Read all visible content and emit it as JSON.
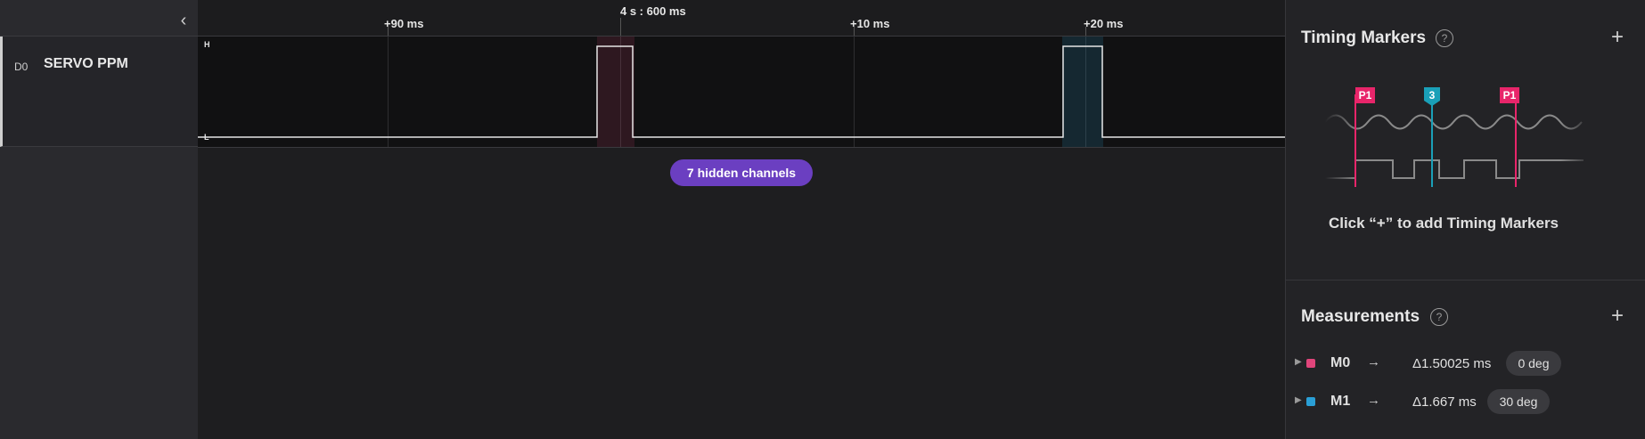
{
  "sidebar": {
    "collapse_icon": "chevron-left-icon",
    "channel": {
      "id": "D0",
      "name": "SERVO PPM"
    }
  },
  "ruler": {
    "cursor_label": "4 s : 600 ms",
    "ticks": [
      "+90 ms",
      "+10 ms",
      "+20 ms"
    ]
  },
  "trace": {
    "high_label": "H",
    "low_label": "L"
  },
  "hidden_channels": "7 hidden channels",
  "timing_markers": {
    "title": "Timing Markers",
    "add_icon": "plus-icon",
    "help_icon": "help-circle-icon",
    "illustration_flags": [
      "P1",
      "3",
      "P1"
    ],
    "hint": "Click “+” to add Timing Markers"
  },
  "measurements": {
    "title": "Measurements",
    "add_icon": "plus-icon",
    "help_icon": "help-circle-icon",
    "items": [
      {
        "name": "M0",
        "color": "#e0457b",
        "arrow": "→",
        "delta": "Δ1.50025 ms",
        "badge": "0 deg"
      },
      {
        "name": "M1",
        "color": "#2a9fd6",
        "arrow": "→",
        "delta": "Δ1.667 ms",
        "badge": "30 deg"
      }
    ]
  },
  "colors": {
    "pulse_highlight_1": "#e0457b",
    "pulse_highlight_2": "#2a9fd6",
    "hidden_pill": "#6b3fc1",
    "marker_pink": "#e8256a",
    "marker_teal": "#1aa0b8"
  }
}
